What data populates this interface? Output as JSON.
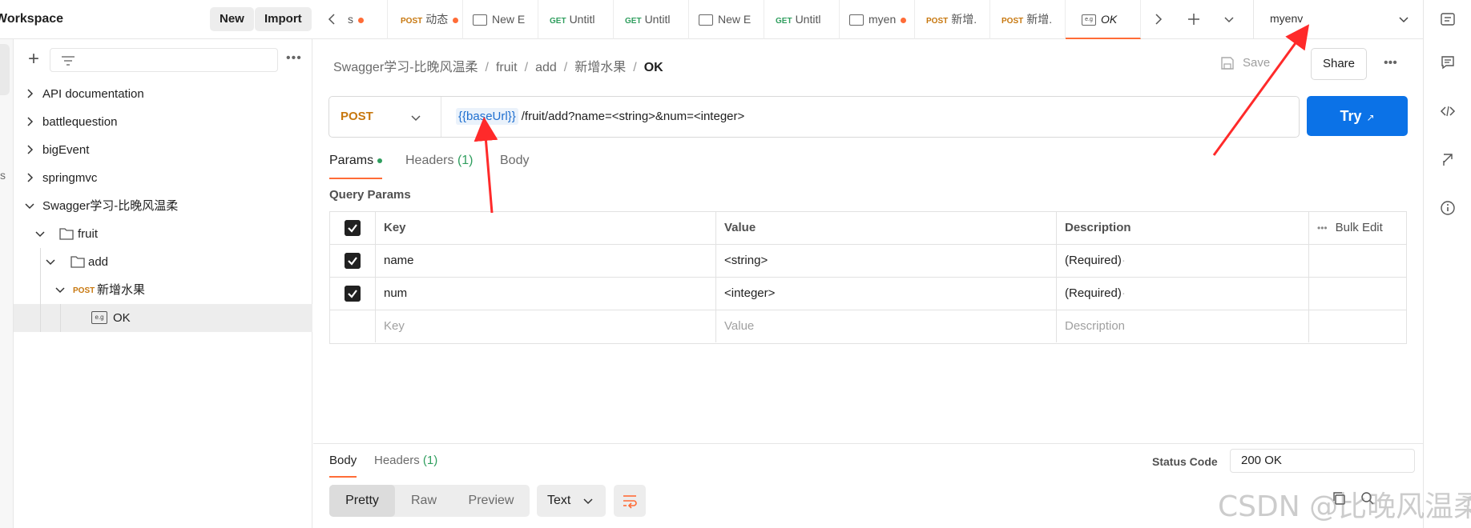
{
  "sidebar": {
    "workspace_title": "Workspace",
    "new_label": "New",
    "import_label": "Import",
    "collapsed_fragment": "s",
    "items": [
      {
        "label": "API documentation",
        "type": "collection",
        "expanded": false
      },
      {
        "label": "battlequestion",
        "type": "collection",
        "expanded": false
      },
      {
        "label": "bigEvent",
        "type": "collection",
        "expanded": false
      },
      {
        "label": "springmvc",
        "type": "collection",
        "expanded": false
      },
      {
        "label": "Swagger学习-比晚风温柔",
        "type": "collection",
        "expanded": true
      },
      {
        "label": "fruit",
        "type": "folder",
        "expanded": true
      },
      {
        "label": "add",
        "type": "folder",
        "expanded": true
      },
      {
        "label": "新增水果",
        "type": "request",
        "method": "POST",
        "expanded": true
      },
      {
        "label": "OK",
        "type": "example",
        "selected": true
      }
    ]
  },
  "tabs": [
    {
      "method": "",
      "label": "s",
      "dot": true,
      "icon": ""
    },
    {
      "method": "POST",
      "label": "动态",
      "dot": true,
      "icon": ""
    },
    {
      "method": "",
      "label": "New E",
      "dot": false,
      "icon": "request-icon"
    },
    {
      "method": "GET",
      "label": "Untitl",
      "dot": false,
      "icon": ""
    },
    {
      "method": "GET",
      "label": "Untitl",
      "dot": false,
      "icon": ""
    },
    {
      "method": "",
      "label": "New E",
      "dot": false,
      "icon": "request-icon"
    },
    {
      "method": "GET",
      "label": "Untitl",
      "dot": false,
      "icon": ""
    },
    {
      "method": "",
      "label": "myen",
      "dot": true,
      "icon": "environment-icon"
    },
    {
      "method": "POST",
      "label": "新增.",
      "dot": false,
      "icon": ""
    },
    {
      "method": "POST",
      "label": "新增.",
      "dot": false,
      "icon": ""
    },
    {
      "method": "",
      "label": "OK",
      "dot": false,
      "icon": "example-icon",
      "active": true
    }
  ],
  "environment": {
    "name": "myenv"
  },
  "breadcrumb": {
    "parts": [
      "Swagger学习-比晚风温柔",
      "fruit",
      "add",
      "新增水果"
    ],
    "current": "OK"
  },
  "actions": {
    "save": "Save",
    "share": "Share"
  },
  "request": {
    "method": "POST",
    "url_variable": "{{baseUrl}}",
    "url_rest": "/fruit/add?name=<string>&num=<integer>",
    "try_label": "Try",
    "try_arrow": "↗"
  },
  "request_tabs": {
    "params": "Params",
    "headers": "Headers",
    "headers_count": "(1)",
    "body": "Body"
  },
  "query_params": {
    "title": "Query Params",
    "columns": {
      "key": "Key",
      "value": "Value",
      "description": "Description",
      "bulk_edit": "Bulk Edit"
    },
    "rows": [
      {
        "key": "name",
        "value": "<string>",
        "description": "(Required)",
        "checked": true
      },
      {
        "key": "num",
        "value": "<integer>",
        "description": "(Required)",
        "checked": true
      }
    ],
    "placeholders": {
      "key": "Key",
      "value": "Value",
      "description": "Description"
    }
  },
  "response": {
    "tabs": {
      "body": "Body",
      "headers": "Headers",
      "headers_count": "(1)"
    },
    "status_label": "Status Code",
    "status_value": "200 OK",
    "views": [
      "Pretty",
      "Raw",
      "Preview"
    ],
    "format": "Text"
  },
  "watermark": "CSDN @比晚风温柔",
  "colors": {
    "accent": "#ff6c37",
    "primary": "#0b72e7",
    "post": "#c7770e",
    "get": "#2f9e5e",
    "annotation": "#ff2a2a"
  }
}
